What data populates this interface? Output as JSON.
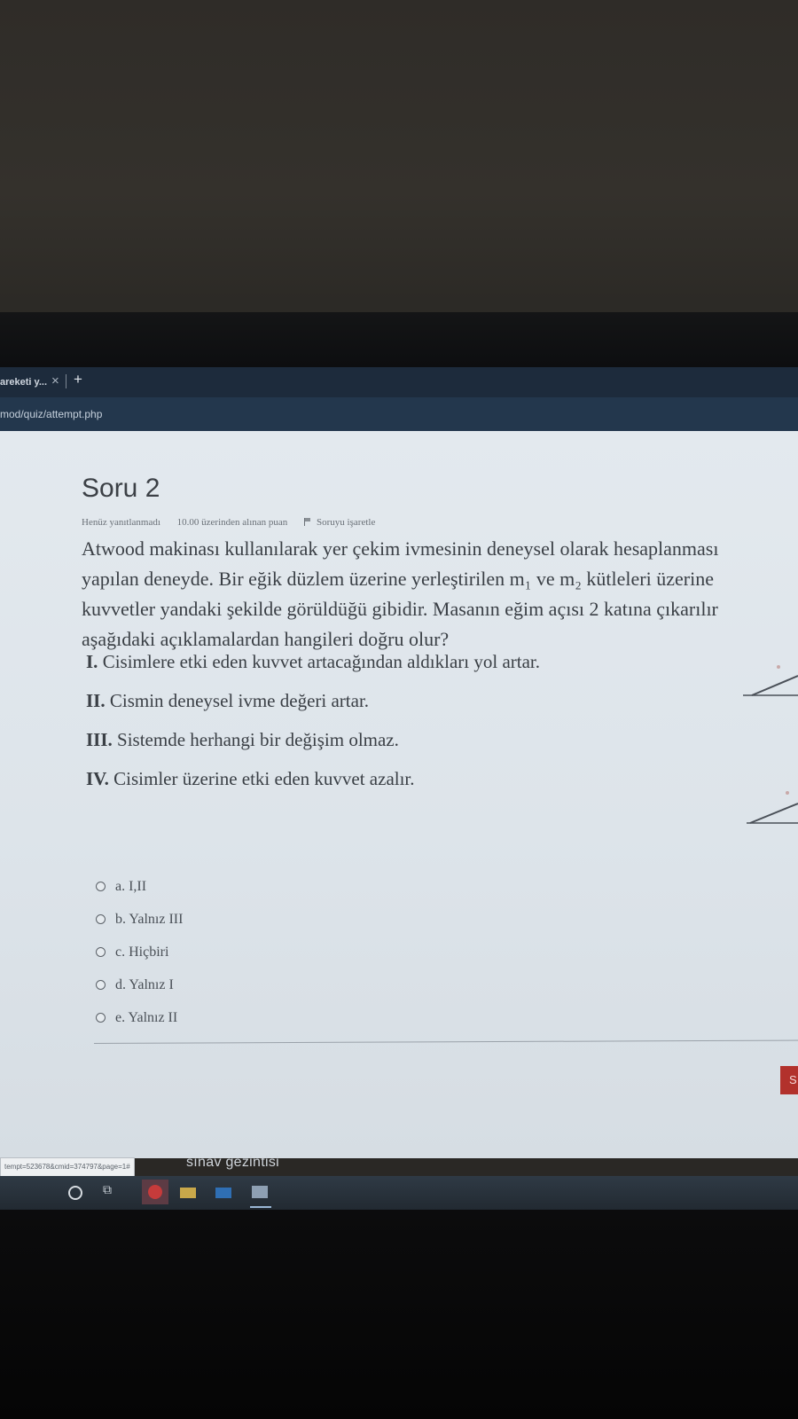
{
  "browser": {
    "tab_label": "areketi y...",
    "tab_close": "×",
    "new_tab": "+",
    "url": "mod/quiz/attempt.php"
  },
  "question": {
    "title": "Soru 2",
    "status": "Henüz yanıtlanmadı",
    "points": "10.00 üzerinden alınan puan",
    "flag_label": "Soruyu işaretle",
    "text_lines": [
      "Atwood makinası kullanılarak yer çekim ivmesinin deneysel olarak hesaplanması",
      "yapılan deneyde. Bir eğik düzlem üzerine yerleştirilen m₁ ve m₂ kütleleri üzerine",
      "kuvvetler yandaki şekilde görüldüğü gibidir. Masanın eğim açısı 2 katına çıkarılır",
      "aşağıdaki açıklamalardan hangileri doğru olur?"
    ],
    "statements": [
      {
        "num": "I.",
        "text": "Cisimlere etki eden kuvvet artacağından aldıkları yol artar."
      },
      {
        "num": "II.",
        "text": "Cismin deneysel ivme değeri artar."
      },
      {
        "num": "III.",
        "text": "Sistemde herhangi bir değişim olmaz."
      },
      {
        "num": "IV.",
        "text": "Cisimler üzerine etki eden kuvvet azalır."
      }
    ],
    "options": [
      {
        "label": "a. I,II"
      },
      {
        "label": "b. Yalnız III"
      },
      {
        "label": "c. Hiçbiri"
      },
      {
        "label": "d. Yalnız I"
      },
      {
        "label": "e. Yalnız II"
      }
    ],
    "next_button": "S"
  },
  "status_bar_url": "tempt=523678&cmid=374797&page=1#",
  "quiz_nav_label": "sınav gezintisi",
  "taskbar": {
    "icons": [
      "search-icon",
      "task-view-icon",
      "chrome-icon",
      "folder-icon",
      "mail-icon",
      "store-icon"
    ]
  },
  "colors": {
    "tab_bar": "#1d2b3c",
    "url_bar": "#23374d",
    "page_bg": "#e3e9ee",
    "next_button": "#b2312c"
  }
}
